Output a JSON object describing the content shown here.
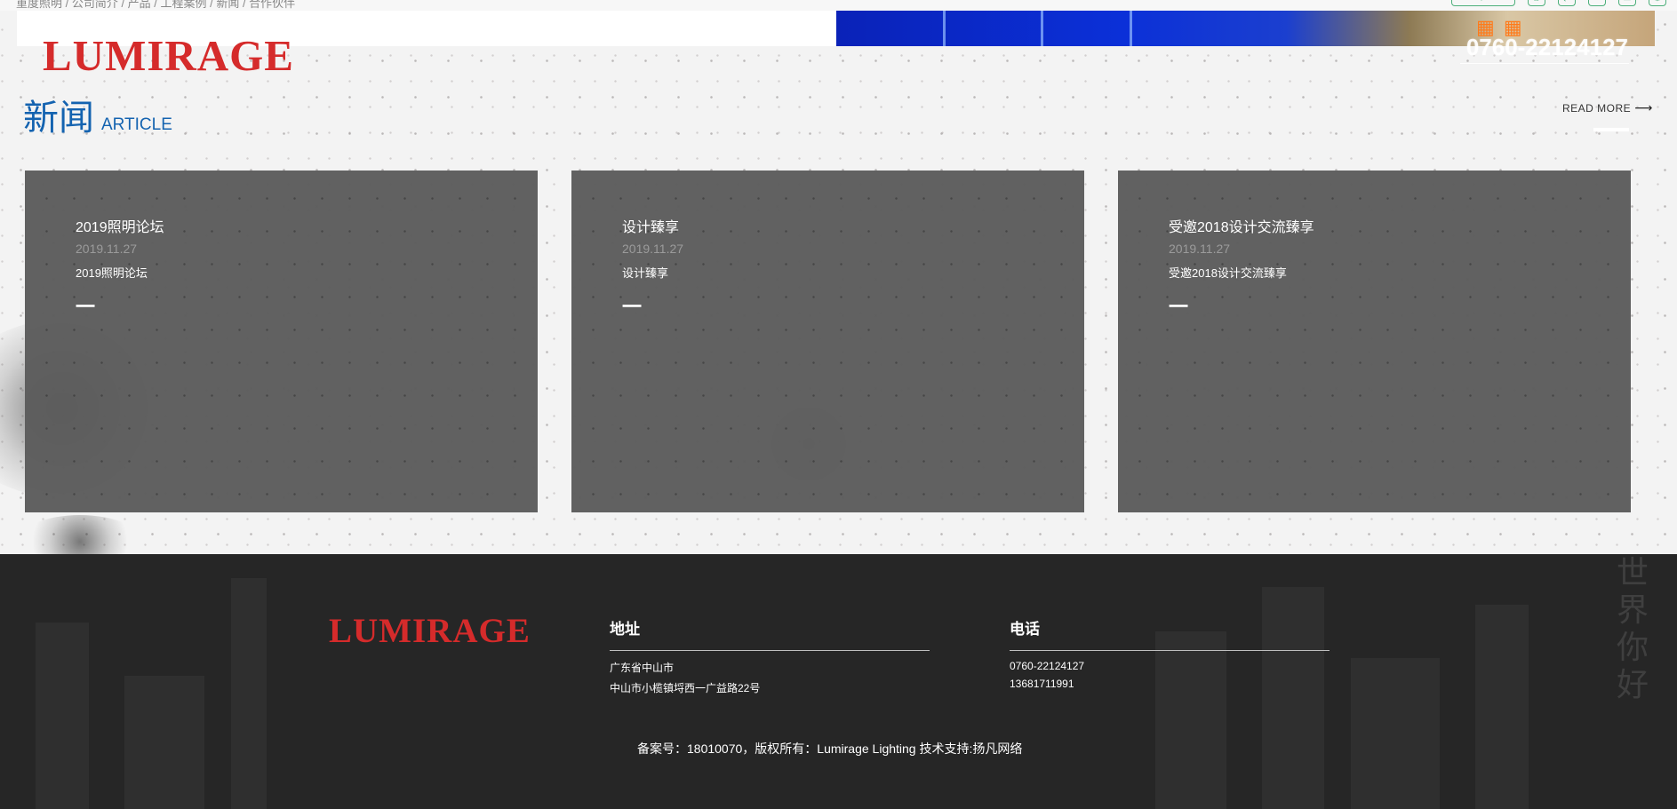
{
  "topbar": {
    "breadcrumb": "重度照明 / 公司简介 / 产品 / 工程案例 / 新闻 / 合作伙伴",
    "icons": [
      "search-icon",
      "home-icon",
      "share-icon",
      "chat-icon",
      "mail-icon",
      "top-icon"
    ]
  },
  "header": {
    "logo": "LUMIRAGE",
    "phone": "0760-22124127"
  },
  "news": {
    "title_zh": "新闻",
    "title_en": "ARTICLE",
    "read_more": "READ MORE",
    "read_more_arrow": "⟶",
    "items": [
      {
        "title": "2019照明论坛",
        "date": "2019.11.27",
        "summary": "2019照明论坛",
        "marker": "一"
      },
      {
        "title": "设计臻享",
        "date": "2019.11.27",
        "summary": "设计臻享",
        "marker": "一"
      },
      {
        "title": "受邀2018设计交流臻享",
        "date": "2019.11.27",
        "summary": "受邀2018设计交流臻享",
        "marker": "一"
      }
    ]
  },
  "footer": {
    "logo": "LUMIRAGE",
    "address": {
      "heading": "地址",
      "lines": [
        "广东省中山市",
        "中山市小榄镇埒西一广益路22号"
      ]
    },
    "phone": {
      "heading": "电话",
      "lines": [
        "0760-22124127",
        "13681711991"
      ]
    },
    "copyright": "备案号：18010070，版权所有：Lumirage Lighting 技术支持:扬凡网络",
    "decor_chars": "世界你好"
  },
  "colors": {
    "brand_red": "#d52b2b",
    "title_blue": "#1463b0",
    "footer_bg": "#262626",
    "card_bg": "#5c5c5c"
  }
}
